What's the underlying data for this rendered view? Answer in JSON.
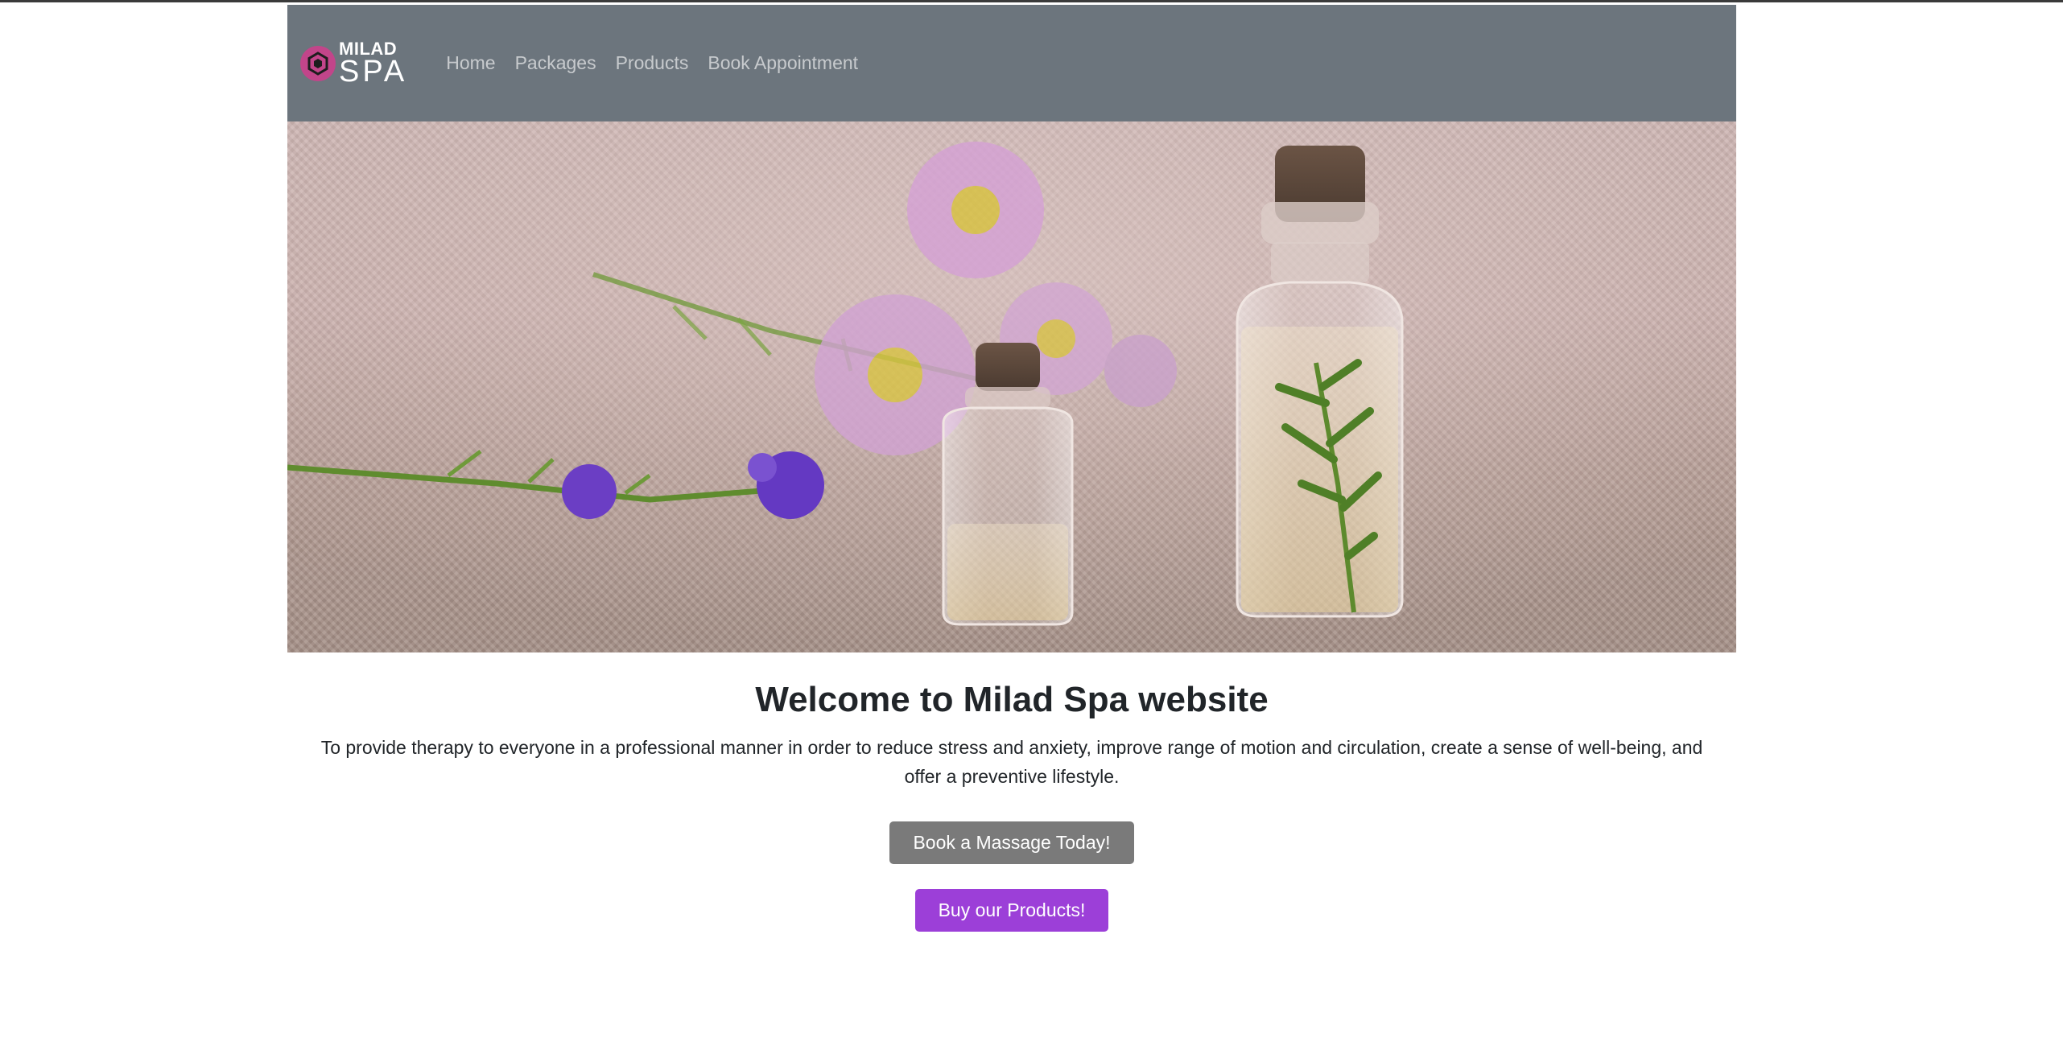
{
  "brand": {
    "line1": "MILAD",
    "line2": "SPA"
  },
  "nav": {
    "items": [
      "Home",
      "Packages",
      "Products",
      "Book Appointment"
    ]
  },
  "main": {
    "title": "Welcome to Milad Spa website",
    "description": "To provide therapy to everyone in a professional manner in order to reduce stress and anxiety, improve range of motion and circulation, create a sense of well-being, and offer a preventive lifestyle.",
    "book_button": "Book a Massage Today!",
    "products_button": "Buy our Products!"
  },
  "colors": {
    "navbar": "#6c757d",
    "logo": "#c2458a",
    "book_button": "#7a7a7a",
    "products_button": "#9c3fd8"
  }
}
